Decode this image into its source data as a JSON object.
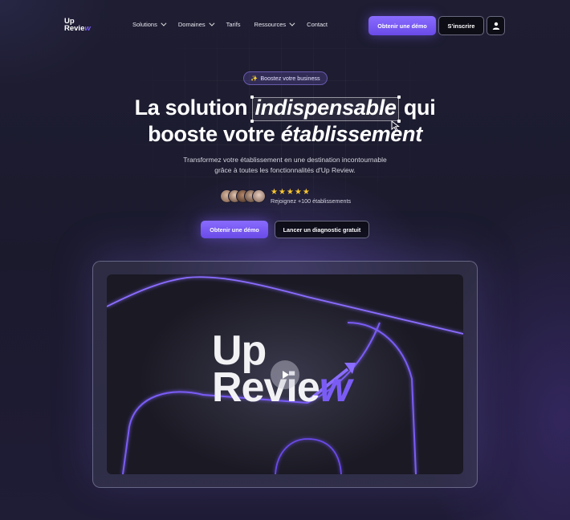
{
  "logo": {
    "line1": "Up",
    "line2_main": "Revie",
    "line2_accent": "w"
  },
  "nav": {
    "items": [
      {
        "label": "Solutions",
        "has_dropdown": true
      },
      {
        "label": "Domaines",
        "has_dropdown": true
      },
      {
        "label": "Tarifs",
        "has_dropdown": false
      },
      {
        "label": "Ressources",
        "has_dropdown": true
      },
      {
        "label": "Contact",
        "has_dropdown": false
      }
    ],
    "demo_label": "Obtenir une démo",
    "signup_label": "S'inscrire",
    "user_icon": "user-icon"
  },
  "hero": {
    "badge_icon": "✨",
    "badge_label": "Boostez votre business",
    "title_line1_before": "La solution ",
    "title_line1_highlight": "indispensable",
    "title_line1_after": " qui",
    "title_line2_before": "booste votre ",
    "title_line2_italic": "établissement",
    "subtitle_line1": "Transformez votre établissement en une destination incontournable",
    "subtitle_line2": "grâce à toutes les fonctionnalités d'Up Review.",
    "rating_stars": 5,
    "stars_text": "★★★★★",
    "joined_text": "Rejoignez +100 établissements",
    "cta_primary": "Obtenir une démo",
    "cta_secondary": "Lancer un diagnostic gratuit"
  },
  "video": {
    "logo_line1": "Up",
    "logo_line2_main": "Revie",
    "logo_line2_accent": "w",
    "play_icon": "play-icon"
  },
  "colors": {
    "accent": "#7a5cf5",
    "background": "#1b1a2e",
    "star": "#f7c531"
  }
}
